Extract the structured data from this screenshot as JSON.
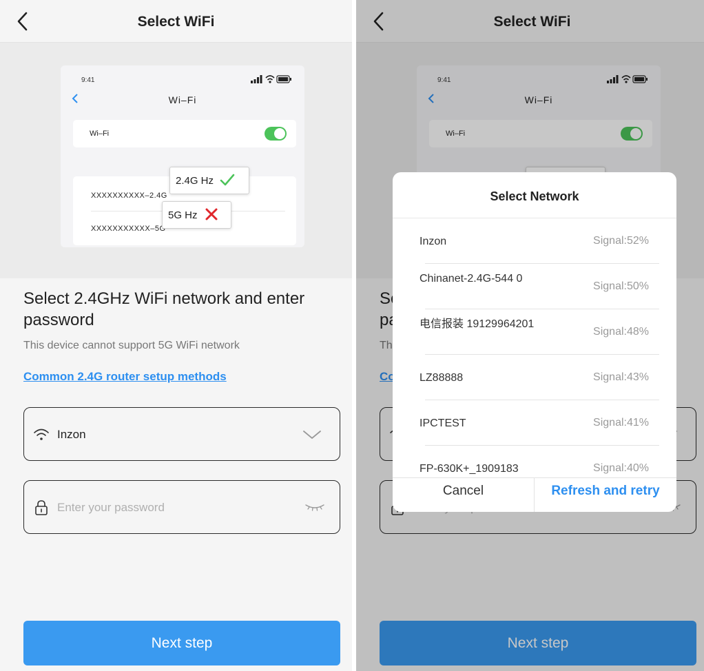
{
  "header": {
    "title": "Select WiFi"
  },
  "illustration": {
    "time": "9:41",
    "title": "Wi–Fi",
    "wifi_label": "Wi–Fi",
    "net_24": "XXXXXXXXXX–2.4G",
    "net_5": "XXXXXXXXXXX–5G",
    "tag_24": "2.4G Hz",
    "tag_5": "5G Hz",
    "colors": {
      "check": "#4cc35a",
      "cross": "#e0262b"
    }
  },
  "content": {
    "title": "Select 2.4GHz WiFi network and enter password",
    "subtitle": "This device cannot support 5G WiFi network",
    "link": "Common 2.4G router setup methods"
  },
  "wifi_field": {
    "value": "Inzon"
  },
  "password_field": {
    "placeholder": "Enter your password"
  },
  "next_button": "Next step",
  "modal": {
    "title": "Select Network",
    "networks": [
      {
        "name": "Inzon",
        "signal": "Signal:52%"
      },
      {
        "name": "Chinanet-2.4G-544 0",
        "signal": "Signal:50%"
      },
      {
        "name": "电信报装 19129964201",
        "signal": "Signal:48%"
      },
      {
        "name": "LZ88888",
        "signal": "Signal:43%"
      },
      {
        "name": "IPCTEST",
        "signal": "Signal:41%"
      },
      {
        "name": "FP-630K+_1909183",
        "signal": "Signal:40%"
      }
    ],
    "cancel": "Cancel",
    "refresh": "Refresh and retry"
  },
  "colors": {
    "accent": "#2d8ff0",
    "button": "#3a9af0",
    "overlay": "rgba(0,0,0,0.22)"
  }
}
